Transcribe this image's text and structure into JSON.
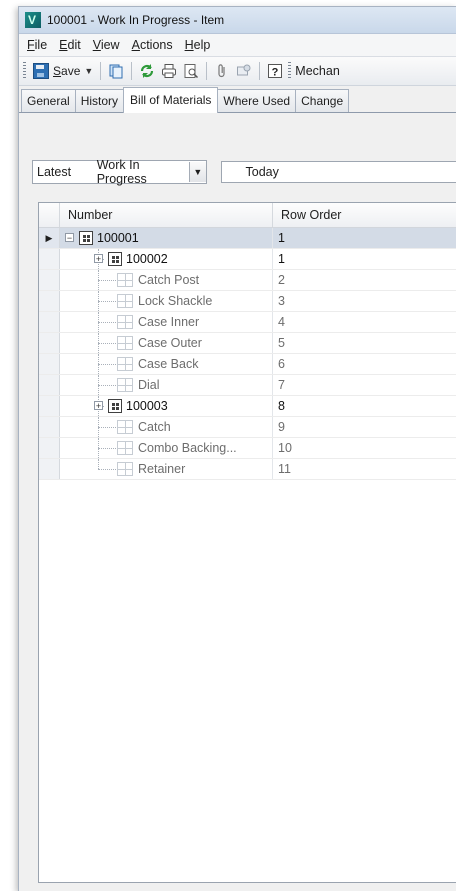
{
  "window": {
    "title": "100001 - Work In Progress - Item"
  },
  "menu": {
    "file": {
      "pre": "",
      "key": "F",
      "post": "ile"
    },
    "edit": {
      "pre": "",
      "key": "E",
      "post": "dit"
    },
    "view": {
      "pre": "",
      "key": "V",
      "post": "iew"
    },
    "actions": {
      "pre": "",
      "key": "A",
      "post": "ctions"
    },
    "help": {
      "pre": "",
      "key": "H",
      "post": "elp"
    }
  },
  "toolbar": {
    "save": {
      "key": "S",
      "post": "ave"
    },
    "category": "Mechan",
    "icons": [
      "copy-icon",
      "refresh-icon",
      "print-icon",
      "print-preview-icon",
      "attach-icon",
      "lifecycle-icon",
      "help-icon"
    ]
  },
  "tabs": [
    "General",
    "History",
    "Bill of Materials",
    "Where Used",
    "Change"
  ],
  "filter": {
    "revision": "Latest",
    "state": "Work In Progress",
    "date": "Today"
  },
  "grid": {
    "columns": [
      "Number",
      "Row Order"
    ],
    "rows": [
      {
        "number": "100001",
        "row_order": "1",
        "kind": "assembly",
        "level": 0,
        "expanded": true,
        "selected": true
      },
      {
        "number": "100002",
        "row_order": "1",
        "kind": "assembly",
        "level": 1,
        "expanded": false
      },
      {
        "number": "Catch Post",
        "row_order": "2",
        "kind": "part",
        "level": 1
      },
      {
        "number": "Lock Shackle",
        "row_order": "3",
        "kind": "part",
        "level": 1
      },
      {
        "number": "Case Inner",
        "row_order": "4",
        "kind": "part",
        "level": 1
      },
      {
        "number": "Case Outer",
        "row_order": "5",
        "kind": "part",
        "level": 1
      },
      {
        "number": "Case Back",
        "row_order": "6",
        "kind": "part",
        "level": 1
      },
      {
        "number": "Dial",
        "row_order": "7",
        "kind": "part",
        "level": 1
      },
      {
        "number": "100003",
        "row_order": "8",
        "kind": "assembly",
        "level": 1,
        "expanded": false
      },
      {
        "number": "Catch",
        "row_order": "9",
        "kind": "part",
        "level": 1
      },
      {
        "number": "Combo Backing...",
        "row_order": "10",
        "kind": "part",
        "level": 1
      },
      {
        "number": "Retainer",
        "row_order": "11",
        "kind": "part",
        "level": 1
      }
    ]
  }
}
